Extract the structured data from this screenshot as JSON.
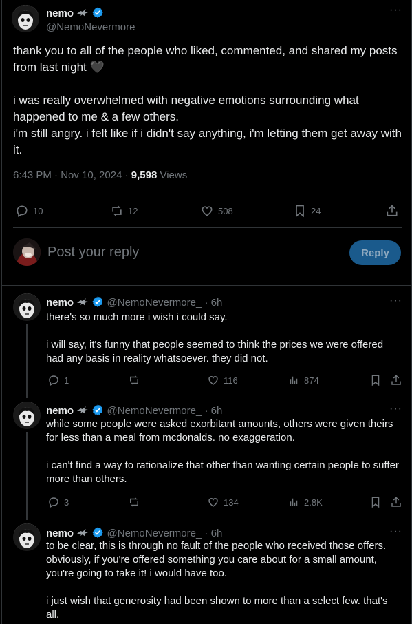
{
  "main_tweet": {
    "author_name": "nemo",
    "author_handle": "@NemoNevermore_",
    "text": "thank you to all of the people who liked, commented, and shared my posts from last night 🖤\n\ni was really overwhelmed with negative emotions surrounding what happened to me & a few others.\ni'm still angry. i felt like if i didn't say anything, i'm letting them get away with it.",
    "time": "6:43 PM · Nov 10, 2024 · ",
    "views_count": "9,598",
    "views_label": "Views",
    "replies": "10",
    "reposts": "12",
    "likes": "508",
    "bookmarks": "24",
    "more": "···"
  },
  "reply_box": {
    "placeholder": "Post your reply",
    "button": "Reply"
  },
  "replies": [
    {
      "name": "nemo",
      "handle": "@NemoNevermore_",
      "time": "· 6h",
      "text": "there's so much more i wish i could say.\n\ni will say, it's funny that people seemed to think the prices we were offered had any basis in reality whatsoever. they did not.",
      "replies": "1",
      "reposts": "",
      "likes": "116",
      "views": "874"
    },
    {
      "name": "nemo",
      "handle": "@NemoNevermore_",
      "time": "· 6h",
      "text": "while some people were asked exorbitant amounts, others were given theirs for less than a meal from mcdonalds. no exaggeration.\n\ni can't find a way to rationalize that other than wanting certain people to suffer more than others.",
      "replies": "3",
      "reposts": "",
      "likes": "134",
      "views": "2.8K"
    },
    {
      "name": "nemo",
      "handle": "@NemoNevermore_",
      "time": "· 6h",
      "text": "to be clear, this is through no fault of the people who received those offers. obviously, if you're offered something you care about for a small amount, you're going to take it! i would have too.\n\ni just wish that generosity had been shown to more than a select few. that's all.",
      "more": "···"
    }
  ],
  "colors": {
    "background": "#000000",
    "text": "#e7e9ea",
    "muted": "#71767b",
    "verified": "#1d9bf0",
    "reply_button": "#1a5a8c"
  },
  "icons": [
    "verified-icon",
    "raven-icon",
    "reply-icon",
    "repost-icon",
    "like-icon",
    "bookmark-icon",
    "share-icon",
    "views-icon",
    "more-icon"
  ]
}
